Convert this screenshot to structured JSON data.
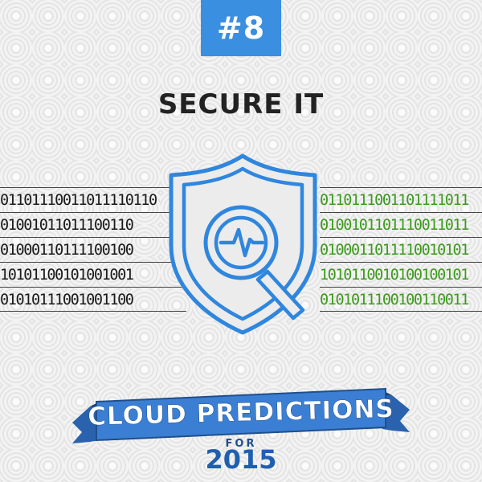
{
  "badge": {
    "text": "#8"
  },
  "title": "SECURE IT",
  "binary": {
    "left": [
      "01101110011011110110",
      "01001011011100110",
      "01000110111100100",
      "10101100101001001",
      "01010111001001100"
    ],
    "right": [
      "0110111001101111011",
      "0100101101110011011",
      "0100011011110010101",
      "1010110010100100101",
      "0101011100100110011"
    ]
  },
  "icon": {
    "name": "shield-magnifier-pulse-icon",
    "color": "#2f86de"
  },
  "banner": {
    "text": "CLOUD PREDICTIONS",
    "for": "FOR",
    "year": "2015",
    "color": "#3b7fd4",
    "dark_color": "#1f4f8c"
  },
  "colors": {
    "badge": "#3b8fe0",
    "title": "#222222",
    "binary_left": "#1a1a1a",
    "binary_right": "#3e9a1e"
  }
}
